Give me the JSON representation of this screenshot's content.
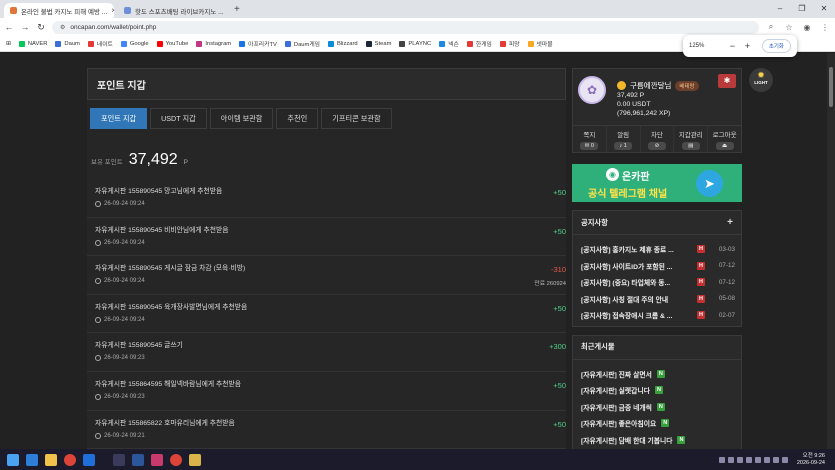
{
  "browser": {
    "tabs": [
      {
        "title": "온라인 불법 카지노 피해 예방 ...",
        "active": true
      },
      {
        "title": "핫도 스포츠배팅 라이브카지노 ...",
        "active": false
      }
    ],
    "url": "oncapan.com/wallet/point.php",
    "bookmarks": [
      "NAVER",
      "Daum",
      "네이트",
      "Google",
      "YouTube",
      "Instagram",
      "아프리카TV",
      "Daum게임",
      "Blizzard",
      "Steam",
      "PLAYNC",
      "넥슨",
      "한게임",
      "피망",
      "넷마블"
    ],
    "zoom": {
      "level": "125%",
      "minus": "−",
      "plus": "+",
      "reset_label": "초기화"
    }
  },
  "wallet": {
    "title": "포인트 지갑",
    "tabs": [
      "포인트 지갑",
      "USDT 지갑",
      "아이템 보관함",
      "추천인",
      "기프티콘 보관함"
    ],
    "balance_label": "보유 포인트",
    "balance_value": "37,492",
    "balance_unit": "P",
    "rows": [
      {
        "desc": "자유게시판 155890545 망고님에게 추천받음",
        "date": "26-09-24 09:24",
        "amount": "+50",
        "extra": ""
      },
      {
        "desc": "자유게시판 155890545 비비안님에게 추천받음",
        "date": "26-09-24 09:24",
        "amount": "+50",
        "extra": ""
      },
      {
        "desc": "자유게시판 155890545 게시글 잠금 차감 (모육·비방)",
        "date": "26-09-24 09:24",
        "amount": "-310",
        "extra": "만료 260924"
      },
      {
        "desc": "자유게시판 155890545 육개장사발면님에게 추천받음",
        "date": "26-09-24 09:24",
        "amount": "+50",
        "extra": ""
      },
      {
        "desc": "자유게시판 155890545 글쓰기",
        "date": "26-09-24 09:23",
        "amount": "+300",
        "extra": ""
      },
      {
        "desc": "자유게시판 155864595 해일넥바람님에게 추천받음",
        "date": "26-09-24 09:23",
        "amount": "+50",
        "extra": ""
      },
      {
        "desc": "자유게시판 155865822 호마유리님에게 추천받음",
        "date": "26-09-24 09:21",
        "amount": "+50",
        "extra": ""
      }
    ]
  },
  "profile": {
    "name": "구름에깐달님",
    "badge": "베테랑",
    "points": "37,492 P",
    "usdt": "0.00 USDT",
    "xp": "(796,961,242 XP)",
    "light_label": "LIGHT",
    "actions": [
      {
        "label": "쪽지",
        "count": "0",
        "icon": "mail-icon"
      },
      {
        "label": "알림",
        "count": "1",
        "icon": "bell-icon"
      },
      {
        "label": "차단",
        "count": "",
        "icon": "block-icon"
      },
      {
        "label": "지갑관리",
        "count": "",
        "icon": "wallet-icon"
      },
      {
        "label": "로그아웃",
        "count": "",
        "icon": "logout-icon"
      }
    ]
  },
  "banner": {
    "line1": "온카판",
    "line2_accent": "공식",
    "line2_rest": "텔레그램 채널"
  },
  "notice": {
    "title": "공지사항",
    "items": [
      {
        "text": "[공지사항] 홍카지노 제휴 종료 ...",
        "date": "03-03"
      },
      {
        "text": "[공지사항] 사이트ID가 포함된 ...",
        "date": "07-12"
      },
      {
        "text": "[공지사항] (중요) 타업체와 동...",
        "date": "07-12"
      },
      {
        "text": "[공지사항] 사칭 절대 주의 안내",
        "date": "05-08"
      },
      {
        "text": "[공지사항] 접속장애시 크롬 & ...",
        "date": "02-07"
      }
    ]
  },
  "recent": {
    "title": "최근게시물",
    "items": [
      {
        "text": "[자유게시판] 진짜 살면서"
      },
      {
        "text": "[자유게시판] 실렛갑니다"
      },
      {
        "text": "[자유게시판] 금증 네개씩"
      },
      {
        "text": "[자유게시판] 좋은아침이요"
      },
      {
        "text": "[자유게시판] 담배 한대 기봅니다"
      }
    ]
  },
  "taskbar": {
    "time": "오전 9:26",
    "date": "2026-09-24"
  },
  "colors": {
    "accent_blue": "#3177b8",
    "positive": "#4fcf8a",
    "negative": "#e05a4a",
    "banner_green": "#2fb07b"
  }
}
